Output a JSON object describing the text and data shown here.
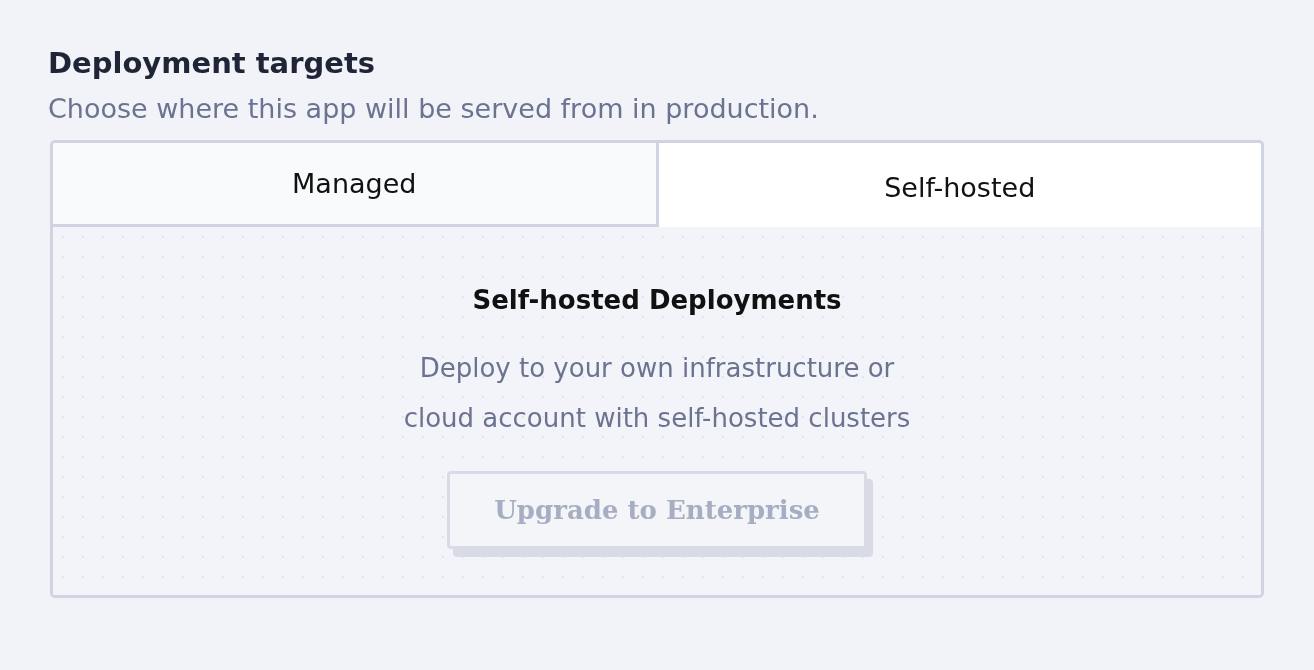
{
  "section": {
    "title": "Deployment targets",
    "description": "Choose where this app will be served from in production."
  },
  "tabs": [
    {
      "label": "Managed",
      "selected": false
    },
    {
      "label": "Self-hosted",
      "selected": true
    }
  ],
  "panel": {
    "heading": "Self-hosted Deployments",
    "lines": [
      "Deploy to your own infrastructure or",
      "cloud account with self-hosted clusters"
    ],
    "button": {
      "label": "Upgrade to Enterprise",
      "disabled": true
    }
  }
}
